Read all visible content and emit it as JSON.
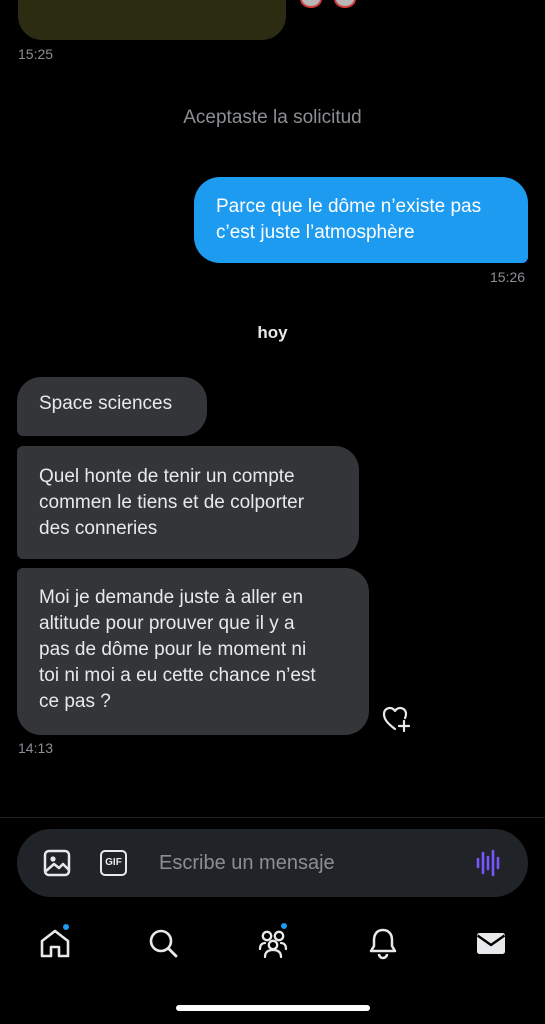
{
  "top": {
    "partial_name": ""
  },
  "thread": {
    "prev_timestamp": "15:25",
    "system_notice": "Aceptaste la solicitud",
    "outgoing": {
      "lines": [
        "Parce que le dôme n’existe pas",
        "c’est juste l’atmosphère"
      ],
      "timestamp": "15:26"
    },
    "day_label": "hoy",
    "incoming": [
      {
        "lines": [
          "Space sciences"
        ]
      },
      {
        "lines": [
          "Quel honte de tenir un compte",
          "commen le tiens et de colporter",
          "des conneries"
        ]
      },
      {
        "lines": [
          "Moi je demande juste à aller en",
          "altitude pour prouver que il y a",
          "pas de dôme pour le moment ni",
          "toi ni moi a eu cette chance n’est",
          "ce pas ?"
        ]
      }
    ],
    "incoming_timestamp": "14:13"
  },
  "composer": {
    "placeholder": "Escribe un mensaje",
    "gif_label": "GIF",
    "icons": [
      "image-icon",
      "gif-icon",
      "voice-wave-icon"
    ]
  },
  "tabbar": {
    "tabs": [
      {
        "name": "home-icon",
        "has_dot": true
      },
      {
        "name": "search-icon",
        "has_dot": false
      },
      {
        "name": "communities-icon",
        "has_dot": true
      },
      {
        "name": "notifications-icon",
        "has_dot": false
      },
      {
        "name": "messages-icon",
        "has_dot": false
      }
    ]
  },
  "colors": {
    "background": "#000000",
    "outgoing_bubble": "#1d9bf0",
    "incoming_bubble": "#333538",
    "muted_text": "#8b8f94",
    "voice_accent": "#7856ff",
    "notification_dot": "#1d9bf0"
  }
}
